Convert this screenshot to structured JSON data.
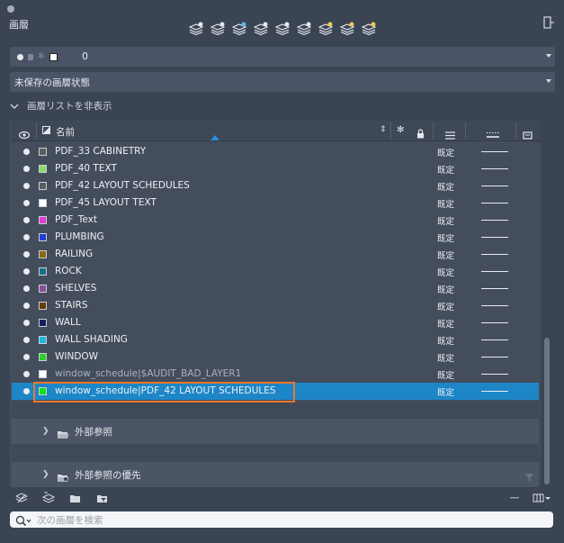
{
  "window": {
    "title": "画層"
  },
  "toolbar": {
    "buttons": [
      {
        "icon": "new-layer-icon"
      },
      {
        "icon": "new-layer-vp-frozen-icon"
      },
      {
        "icon": "layer-match-icon"
      },
      {
        "icon": "layer-previous-icon"
      },
      {
        "icon": "layer-isolate-icon"
      },
      {
        "icon": "layer-freeze-icon"
      },
      {
        "icon": "layer-on-icon"
      },
      {
        "icon": "layer-lock-icon"
      },
      {
        "icon": "layer-unlock-icon"
      }
    ]
  },
  "current_layer": {
    "name": "0",
    "swatch_color": "#ffffff"
  },
  "layer_state": {
    "value": "未保存の画層状態"
  },
  "list_toggle": {
    "label": "画層リストを非表示"
  },
  "table": {
    "name_header": "名前",
    "rows": [
      {
        "name": "PDF_33 CABINETRY",
        "color": "#5d5d5d",
        "linetype": "既定",
        "dim": false
      },
      {
        "name": "PDF_40 TEXT",
        "color": "#8fdc6a",
        "linetype": "既定",
        "dim": false
      },
      {
        "name": "PDF_42 LAYOUT SCHEDULES",
        "color": "#5d5d5d",
        "linetype": "既定",
        "dim": false
      },
      {
        "name": "PDF_45 LAYOUT TEXT",
        "color": "#ffffff",
        "linetype": "既定",
        "dim": false
      },
      {
        "name": "PDF_Text",
        "color": "#e23ad7",
        "linetype": "既定",
        "dim": false
      },
      {
        "name": "PLUMBING",
        "color": "#1f3fd6",
        "linetype": "既定",
        "dim": false
      },
      {
        "name": "RAILING",
        "color": "#8a6a10",
        "linetype": "既定",
        "dim": false
      },
      {
        "name": "ROCK",
        "color": "#1a6f8a",
        "linetype": "既定",
        "dim": false
      },
      {
        "name": "SHELVES",
        "color": "#8a4f9a",
        "linetype": "既定",
        "dim": false
      },
      {
        "name": "STAIRS",
        "color": "#6a3a0a",
        "linetype": "既定",
        "dim": false
      },
      {
        "name": "WALL",
        "color": "#14205e",
        "linetype": "既定",
        "dim": false
      },
      {
        "name": "WALL SHADING",
        "color": "#1fb6e0",
        "linetype": "既定",
        "dim": false
      },
      {
        "name": "WINDOW",
        "color": "#2ecf2e",
        "linetype": "既定",
        "dim": false
      },
      {
        "name": "window_schedule|$AUDIT_BAD_LAYER1",
        "color": "#ffffff",
        "linetype": "既定",
        "dim": true
      },
      {
        "name": "window_schedule|PDF_42 LAYOUT SCHEDULES",
        "color": "#16e016",
        "linetype": "既定",
        "dim": false,
        "selected": true
      }
    ]
  },
  "groups": [
    {
      "label": "外部参照"
    },
    {
      "label": "外部参照の優先"
    }
  ],
  "search": {
    "placeholder": "次の画層を検索",
    "value": ""
  },
  "colors": {
    "accent": "#1d86c7",
    "highlight": "#e8772e",
    "background": "#3b4453"
  }
}
